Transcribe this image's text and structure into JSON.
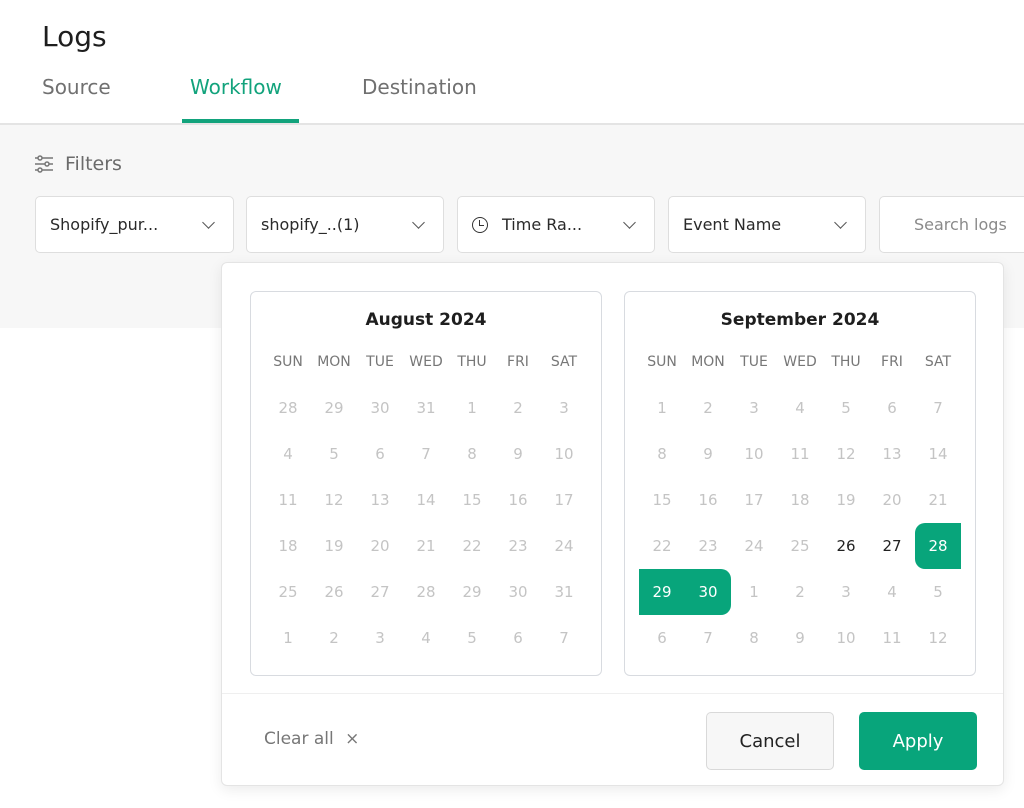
{
  "header": {
    "title": "Logs"
  },
  "tabs": [
    {
      "label": "Source"
    },
    {
      "label": "Workflow",
      "active": true
    },
    {
      "label": "Destination"
    }
  ],
  "filters": {
    "label": "Filters",
    "source": "Shopify_pur...",
    "workflow": "shopify_..(1)",
    "time_range": "Time Ra...",
    "event_name": "Event Name",
    "search_placeholder": "Search logs"
  },
  "colors": {
    "accent": "#08a57b"
  },
  "calendar": {
    "weekdays": [
      "SUN",
      "MON",
      "TUE",
      "WED",
      "THU",
      "FRI",
      "SAT"
    ],
    "months": [
      {
        "title": "August 2024",
        "weeks": [
          [
            "28",
            "29",
            "30",
            "31",
            "1",
            "2",
            "3"
          ],
          [
            "4",
            "5",
            "6",
            "7",
            "8",
            "9",
            "10"
          ],
          [
            "11",
            "12",
            "13",
            "14",
            "15",
            "16",
            "17"
          ],
          [
            "18",
            "19",
            "20",
            "21",
            "22",
            "23",
            "24"
          ],
          [
            "25",
            "26",
            "27",
            "28",
            "29",
            "30",
            "31"
          ],
          [
            "1",
            "2",
            "3",
            "4",
            "5",
            "6",
            "7"
          ]
        ]
      },
      {
        "title": "September 2024",
        "weeks": [
          [
            "1",
            "2",
            "3",
            "4",
            "5",
            "6",
            "7"
          ],
          [
            "8",
            "9",
            "10",
            "11",
            "12",
            "13",
            "14"
          ],
          [
            "15",
            "16",
            "17",
            "18",
            "19",
            "20",
            "21"
          ],
          [
            "22",
            "23",
            "24",
            "25",
            {
              "d": "26",
              "state": "available"
            },
            {
              "d": "27",
              "state": "available"
            },
            {
              "d": "28",
              "state": "range-start"
            }
          ],
          [
            {
              "d": "29",
              "state": "range-mid"
            },
            {
              "d": "30",
              "state": "range-end"
            },
            "1",
            "2",
            "3",
            "4",
            "5"
          ],
          [
            "6",
            "7",
            "8",
            "9",
            "10",
            "11",
            "12"
          ]
        ]
      }
    ]
  },
  "footer": {
    "clear_all": "Clear all",
    "clear_icon": "×",
    "cancel": "Cancel",
    "apply": "Apply"
  }
}
